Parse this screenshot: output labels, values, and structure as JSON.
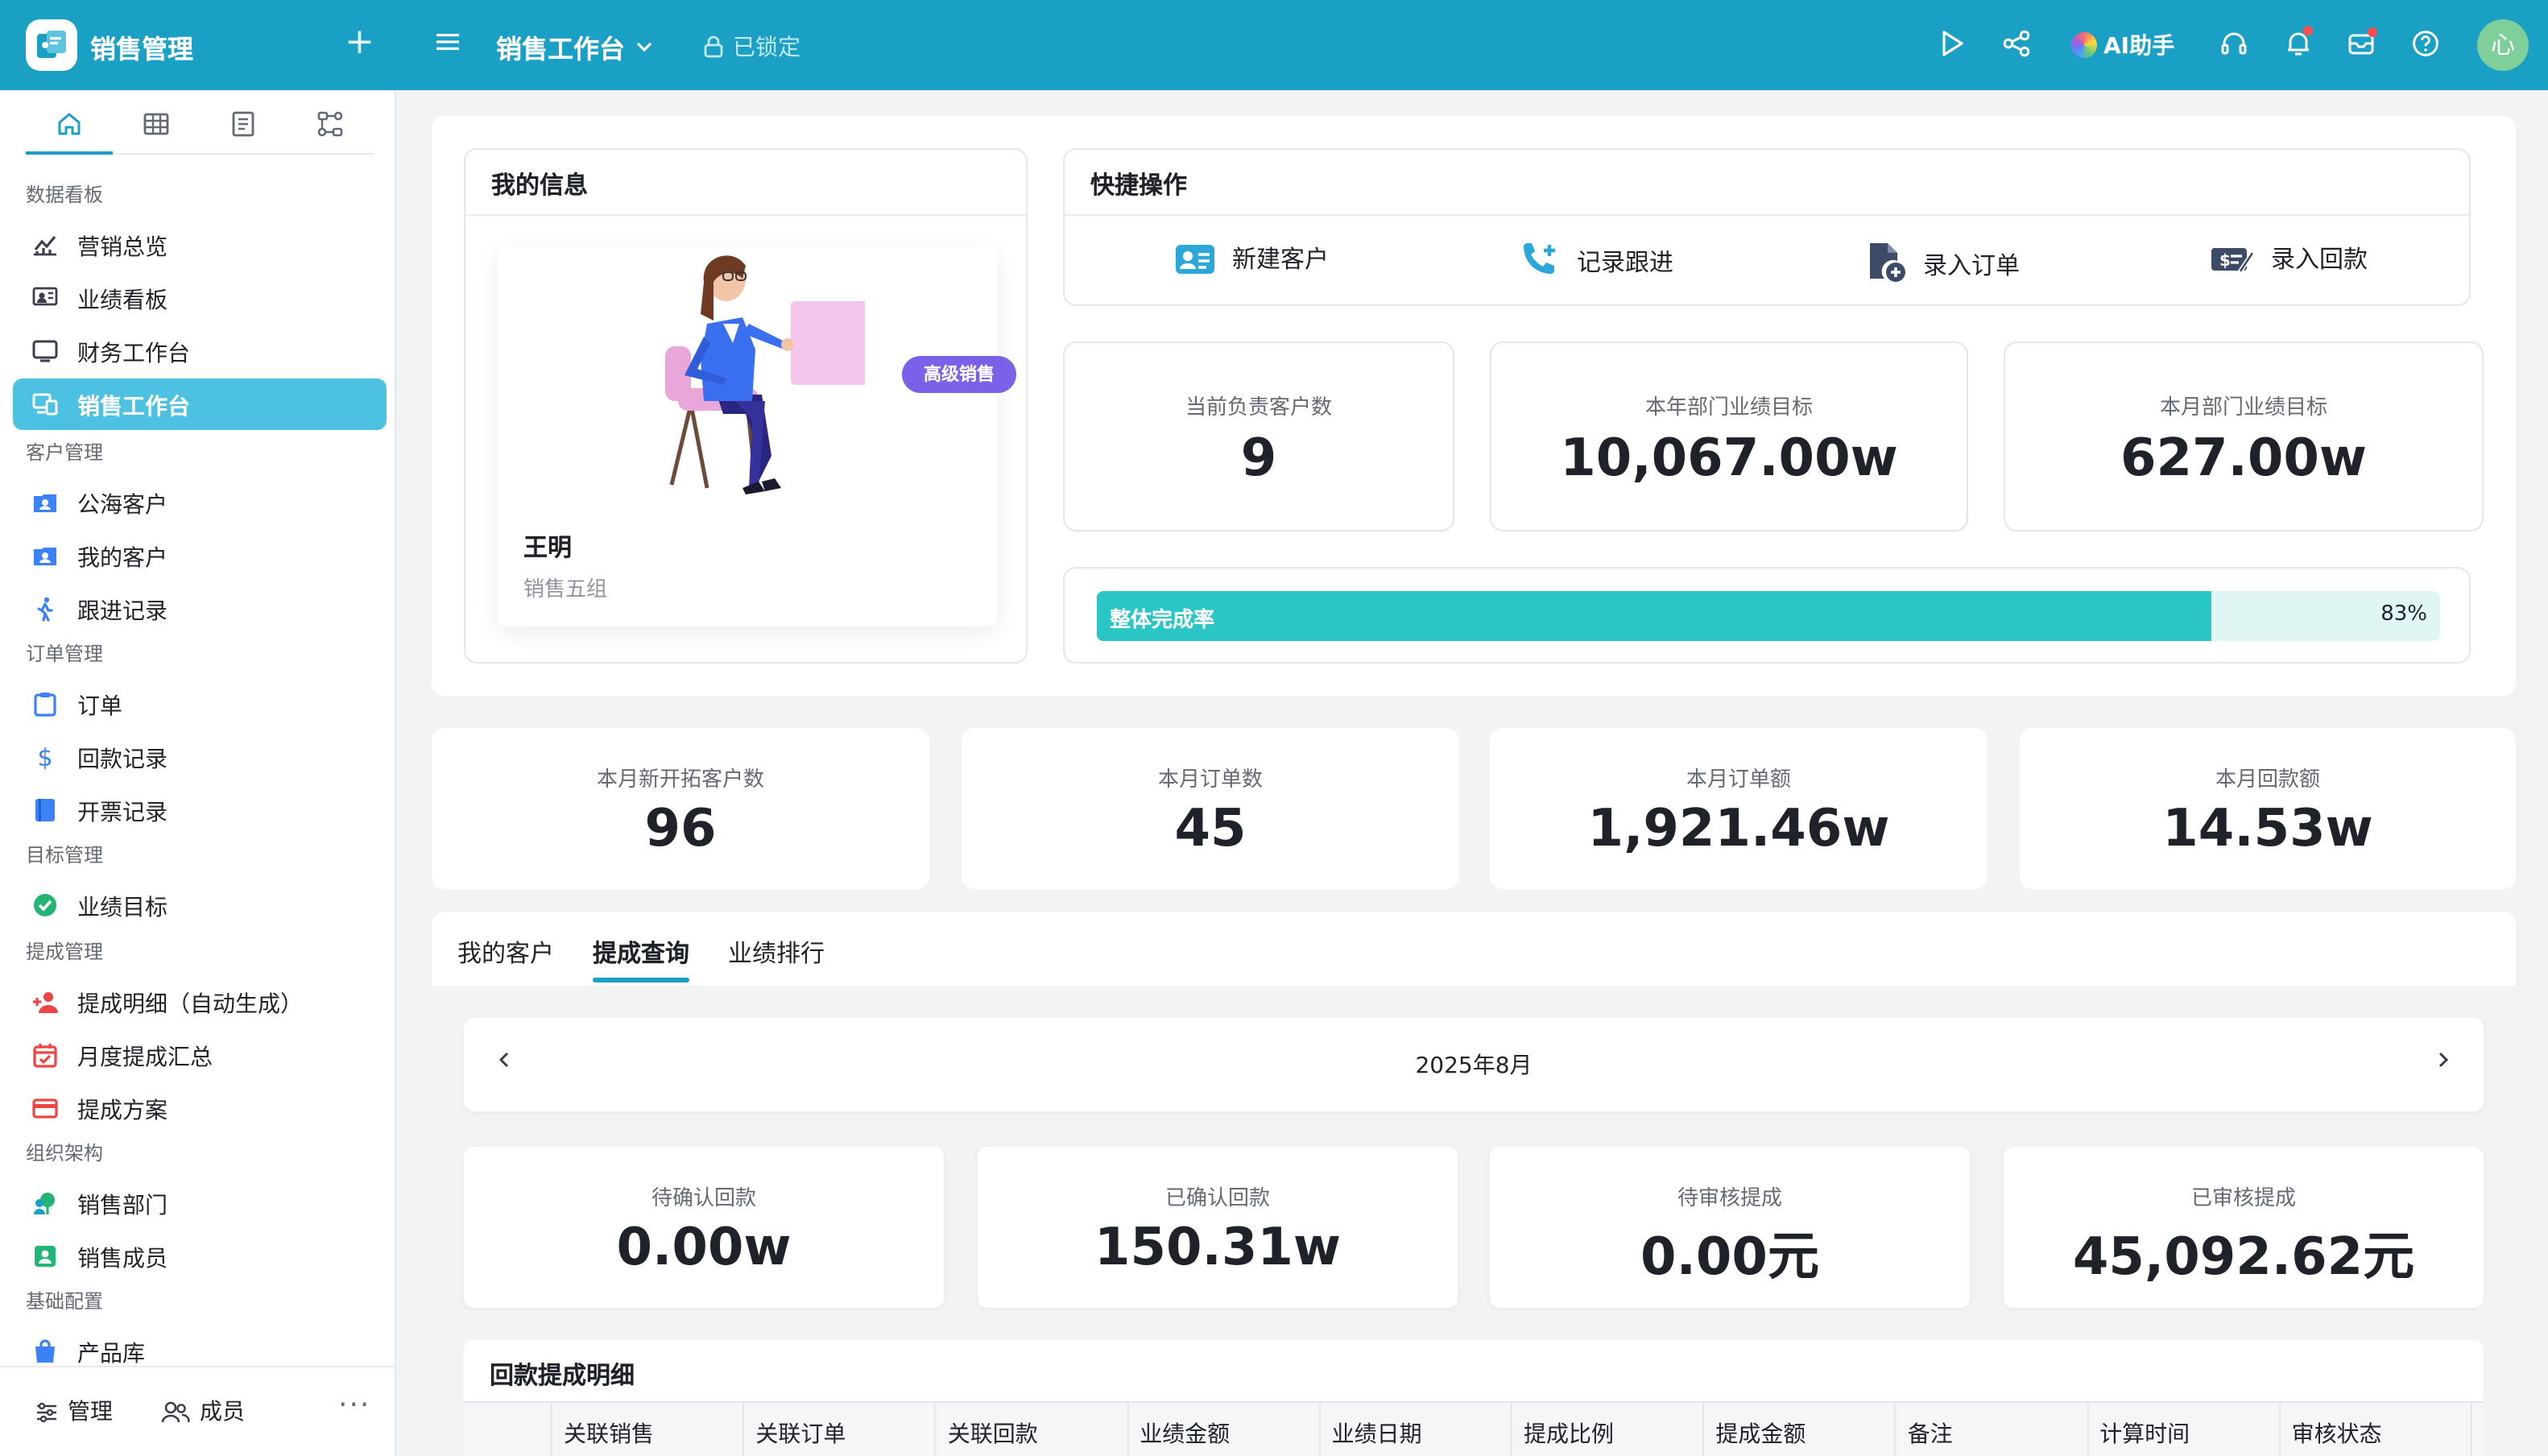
{
  "app": {
    "name": "销售管理",
    "workspace_title": "销售工作台",
    "lock_label": "已锁定",
    "ai_label": "AI助手",
    "avatar_text": "心"
  },
  "sidebar": {
    "groups": [
      {
        "title": "数据看板",
        "items": [
          "营销总览",
          "业绩看板",
          "财务工作台",
          "销售工作台"
        ]
      },
      {
        "title": "客户管理",
        "items": [
          "公海客户",
          "我的客户",
          "跟进记录"
        ]
      },
      {
        "title": "订单管理",
        "items": [
          "订单",
          "回款记录",
          "开票记录"
        ]
      },
      {
        "title": "目标管理",
        "items": [
          "业绩目标"
        ]
      },
      {
        "title": "提成管理",
        "items": [
          "提成明细（自动生成）",
          "月度提成汇总",
          "提成方案"
        ]
      },
      {
        "title": "组织架构",
        "items": [
          "销售部门",
          "销售成员"
        ]
      },
      {
        "title": "基础配置",
        "items": [
          "产品库"
        ]
      }
    ],
    "active_item": "销售工作台",
    "bottom": {
      "manage": "管理",
      "members": "成员",
      "more": "···"
    }
  },
  "my_info": {
    "title": "我的信息",
    "badge": "高级销售",
    "name": "王明",
    "group": "销售五组"
  },
  "quick_actions": {
    "title": "快捷操作",
    "items": [
      "新建客户",
      "记录跟进",
      "录入订单",
      "录入回款"
    ]
  },
  "top_stats": [
    {
      "label": "当前负责客户数",
      "value": "9"
    },
    {
      "label": "本年部门业绩目标",
      "value": "10,067.00w"
    },
    {
      "label": "本月部门业绩目标",
      "value": "627.00w"
    }
  ],
  "progress": {
    "label": "整体完成率",
    "value": 83,
    "text": "83%"
  },
  "month_stats": [
    {
      "label": "本月新开拓客户数",
      "value": "96"
    },
    {
      "label": "本月订单数",
      "value": "45"
    },
    {
      "label": "本月订单额",
      "value": "1,921.46w"
    },
    {
      "label": "本月回款额",
      "value": "14.53w"
    }
  ],
  "tabs": {
    "items": [
      "我的客户",
      "提成查询",
      "业绩排行"
    ],
    "active": "提成查询"
  },
  "month_picker": {
    "label": "2025年8月"
  },
  "commission_stats": [
    {
      "label": "待确认回款",
      "value": "0.00w"
    },
    {
      "label": "已确认回款",
      "value": "150.31w"
    },
    {
      "label": "待审核提成",
      "value": "0.00元"
    },
    {
      "label": "已审核提成",
      "value": "45,092.62元"
    }
  ],
  "table": {
    "title": "回款提成明细",
    "columns": [
      "关联销售",
      "关联订单",
      "关联回款",
      "业绩金额",
      "业绩日期",
      "提成比例",
      "提成金额",
      "备注",
      "计算时间",
      "审核状态"
    ]
  },
  "colors": {
    "brand": "#1aa0c4",
    "active_nav": "#4cc1e2",
    "badge": "#7b61e8",
    "progress": "#2ac6c6"
  }
}
